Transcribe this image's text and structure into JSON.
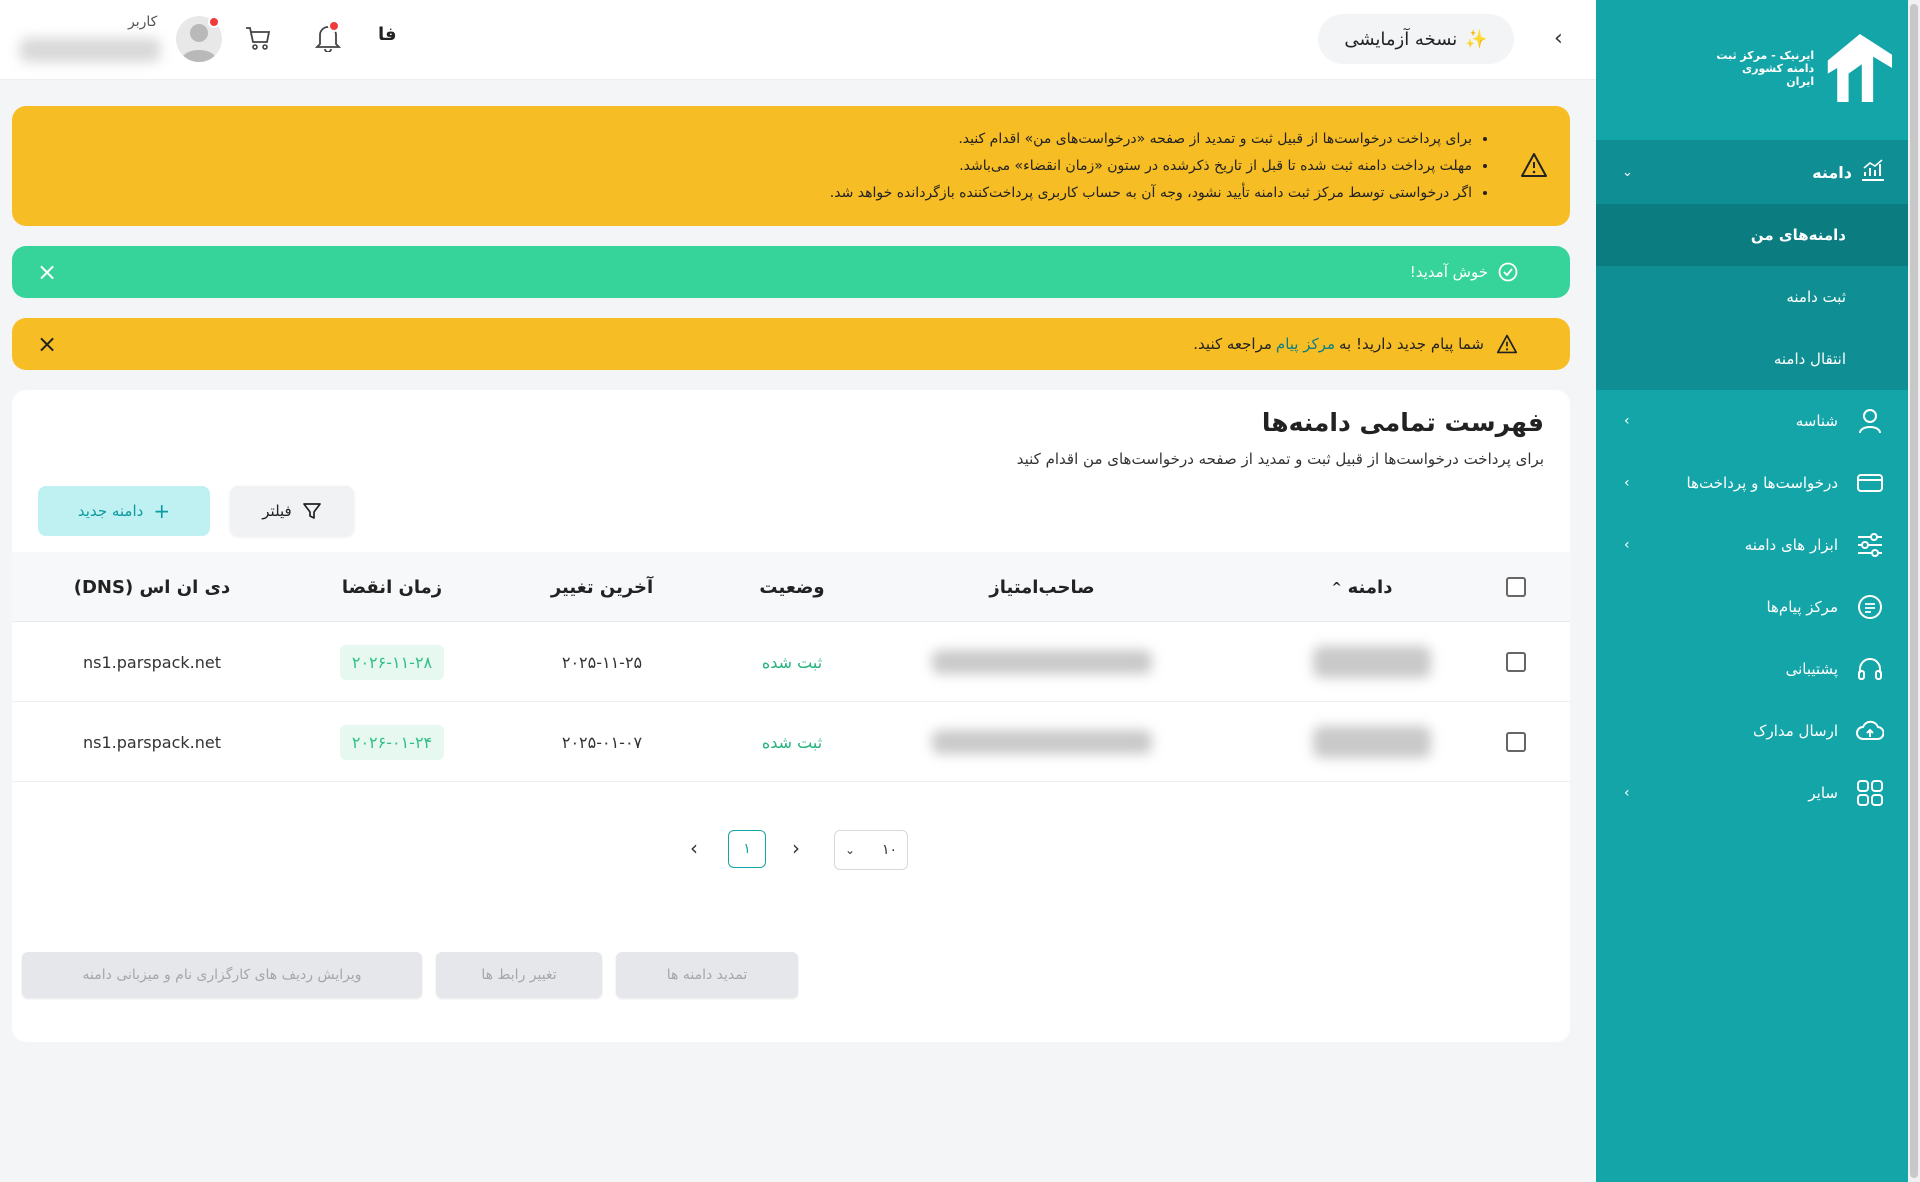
{
  "sidebar": {
    "logo_line1": "ایرنیک - مرکز ثبت",
    "logo_line2": "دامنه کشوری ایران",
    "section": "دامنه",
    "sub_items": [
      "دامنه‌های من",
      "ثبت دامنه",
      "انتقال دامنه"
    ],
    "items": [
      "شناسه",
      "درخواست‌ها و پرداخت‌ها",
      "ابزار های دامنه",
      "مرکز پیام‌ها",
      "پشتیبانی",
      "ارسال مدارک",
      "سایر"
    ]
  },
  "topbar": {
    "trial": "نسخه آزمایشی",
    "lang": "فا",
    "user_label": "کاربر"
  },
  "alerts": {
    "info_bullets": [
      "برای پرداخت درخواست‌ها از قبیل ثبت و تمدید از صفحه «درخواست‌های من» اقدام کنید.",
      "مهلت پرداخت دامنه ثبت شده تا قبل از تاریخ ذکرشده در ستون «زمان انقضاء» می‌باشد.",
      "اگر درخواستی توسط مرکز ثبت دامنه تأیید نشود، وجه آن به حساب کاربری پرداخت‌کننده بازگردانده خواهد شد."
    ],
    "welcome": "خوش آمدید!",
    "message_prefix": "شما پیام جدید دارید! به",
    "message_link": "مرکز پیام",
    "message_suffix": "مراجعه کنید."
  },
  "card": {
    "title": "فهرست تمامی دامنه‌ها",
    "subtitle": "برای پرداخت درخواست‌ها از قبیل ثبت و تمدید از صفحه درخواست‌های من اقدام کنید",
    "filter_label": "فیلتر",
    "new_domain_label": "دامنه جدید"
  },
  "table": {
    "headers": {
      "domain": "دامنه",
      "owner": "صاحب‌امتیاز",
      "status": "وضعیت",
      "last_change": "آخرین تغییر",
      "expiry": "زمان انقضا",
      "dns": "دی ان اس (DNS)"
    },
    "rows": [
      {
        "status": "ثبت شده",
        "last_change": "۲۰۲۵-۱۱-۲۵",
        "expiry": "۲۰۲۶-۱۱-۲۸",
        "dns": "ns1.parspack.net"
      },
      {
        "status": "ثبت شده",
        "last_change": "۲۰۲۵-۰۱-۰۷",
        "expiry": "۲۰۲۶-۰۱-۲۴",
        "dns": "ns1.parspack.net"
      }
    ]
  },
  "pager": {
    "current": "۱",
    "page_size": "۱۰"
  },
  "actions": {
    "renew": "تمدید دامنه ها",
    "change_contacts": "تغییر رابط ها",
    "edit_dns": "ویرایش ردیف های کارگزاری نام و میزبانی دامنه"
  },
  "colors": {
    "sidebar": "#14a5a8",
    "warning": "#f7bd24",
    "success": "#36d39a",
    "accent": "#0e9aa0"
  }
}
